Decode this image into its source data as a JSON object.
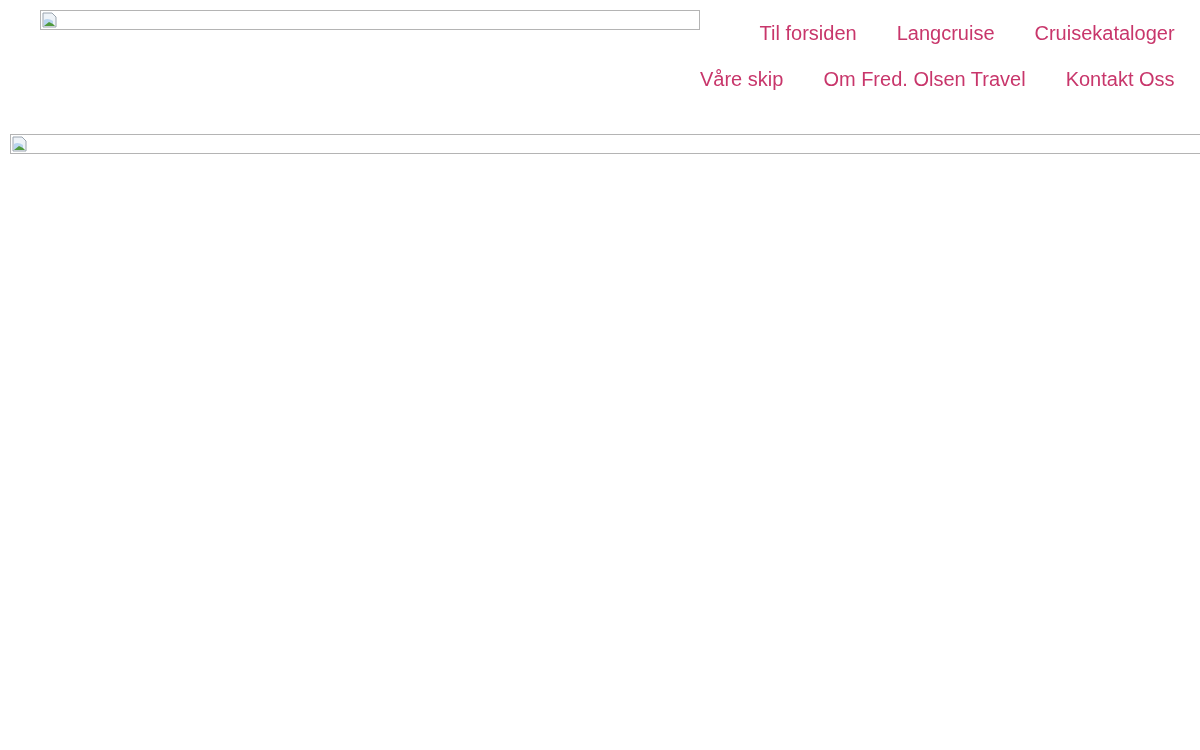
{
  "header": {
    "nav_rows": [
      [
        {
          "label": "Til forsiden"
        },
        {
          "label": "Langcruise"
        },
        {
          "label": "Cruisekataloger"
        }
      ],
      [
        {
          "label": "Våre skip"
        },
        {
          "label": "Om Fred. Olsen Travel"
        },
        {
          "label": "Kontakt Oss"
        }
      ]
    ]
  }
}
